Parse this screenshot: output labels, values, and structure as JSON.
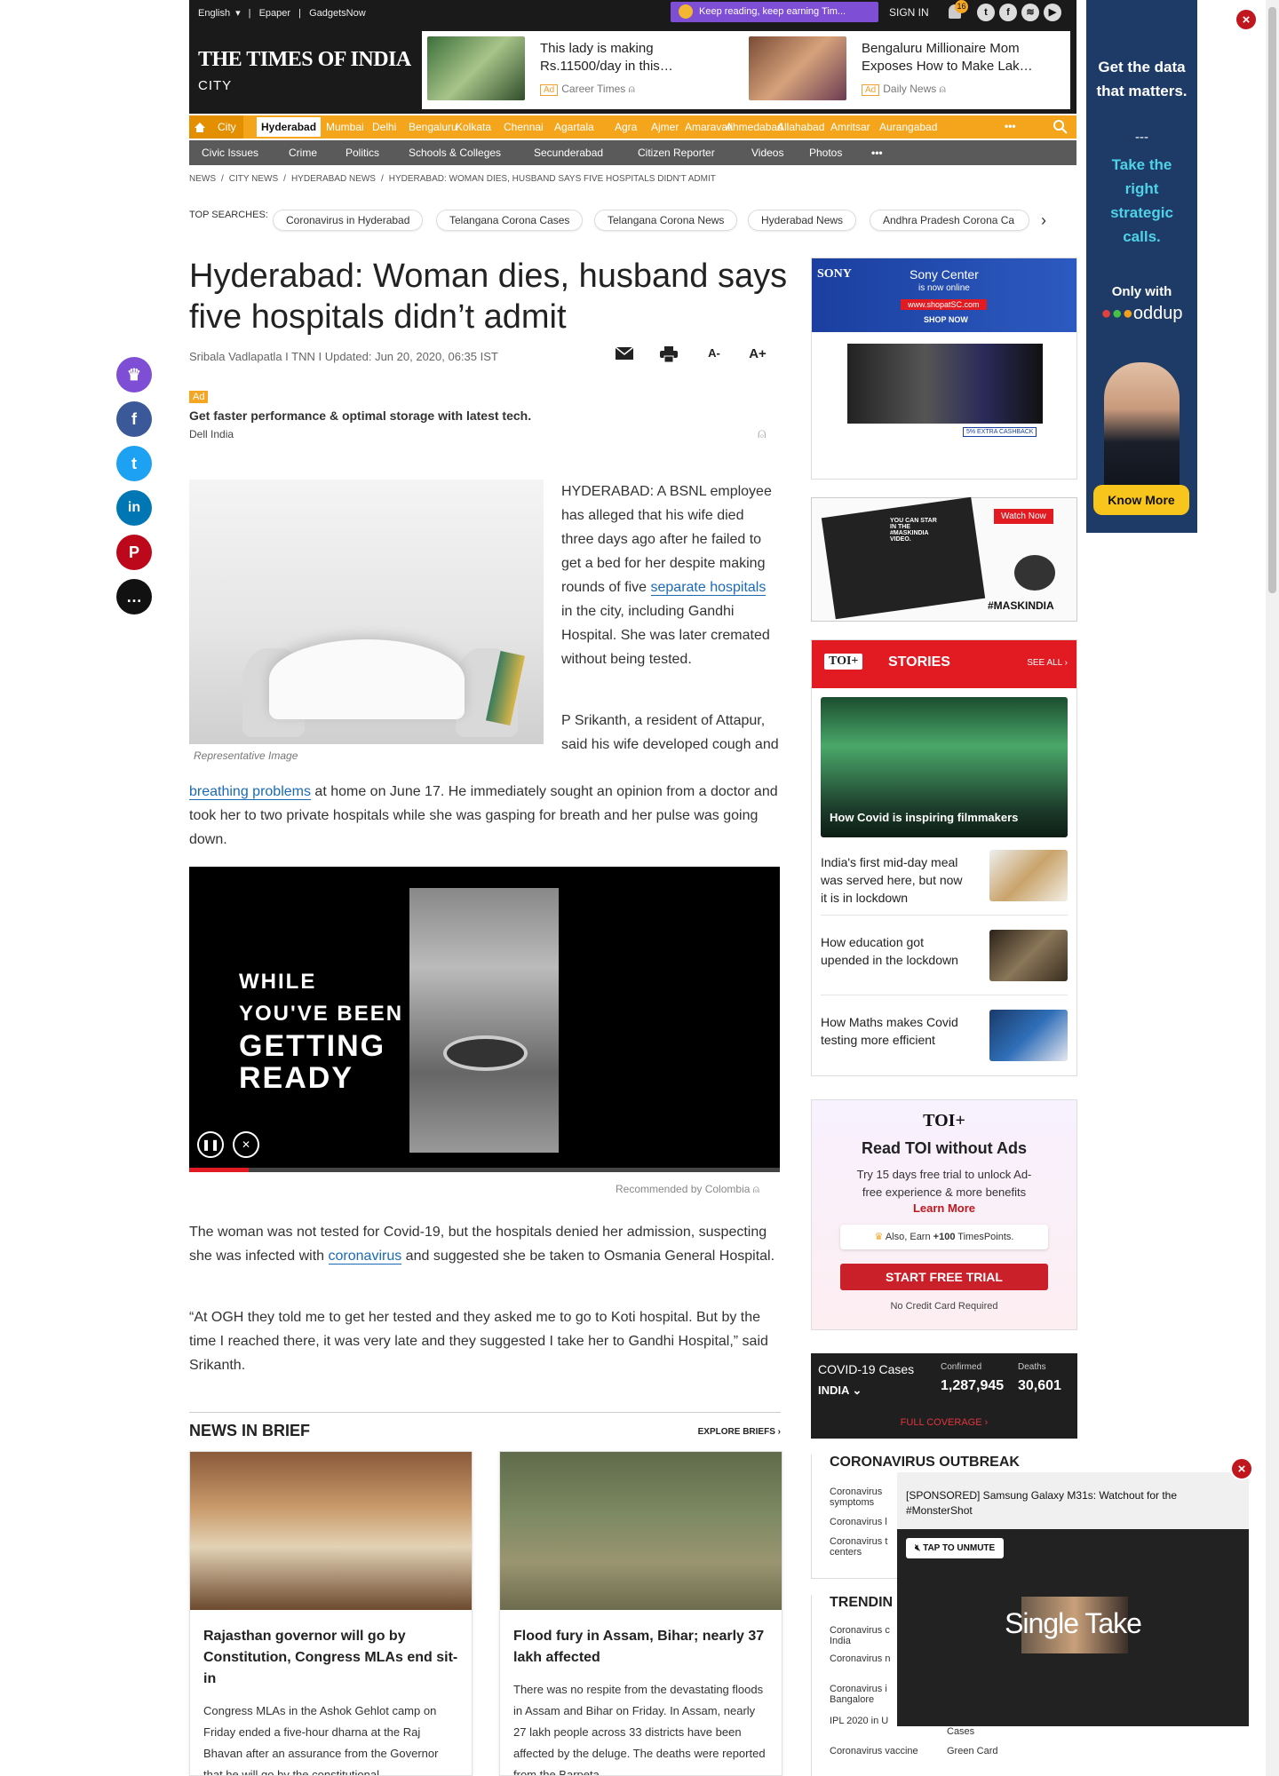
{
  "topbar": {
    "lang": "English",
    "epaper": "Epaper",
    "gadgets": "GadgetsNow",
    "promo": "Keep reading, keep earning Tim...",
    "signin": "SIGN IN",
    "notif_count": "16"
  },
  "header": {
    "logo": "THE TIMES OF INDIA",
    "section": "CITY",
    "ads": [
      {
        "title": "This lady is making Rs.11500/day in this…",
        "ad": "Ad",
        "source": "Career Times"
      },
      {
        "title": "Bengaluru Millionaire Mom Exposes How to Make Lak…",
        "ad": "Ad",
        "source": "Daily News"
      }
    ]
  },
  "nav": {
    "city": "City",
    "cities": [
      "Hyderabad",
      "Mumbai",
      "Delhi",
      "Bengaluru",
      "Kolkata",
      "Chennai",
      "Agartala",
      "Agra",
      "Ajmer",
      "Amaravati",
      "Ahmedabad",
      "Allahabad",
      "Amritsar",
      "Aurangabad"
    ],
    "more": "•••",
    "sub": [
      "Civic Issues",
      "Crime",
      "Politics",
      "Schools & Colleges",
      "Secunderabad",
      "Citizen Reporter",
      "Videos",
      "Photos",
      "•••"
    ]
  },
  "breadcrumb": [
    "NEWS",
    "/",
    "CITY NEWS",
    "/",
    "HYDERABAD NEWS",
    "/",
    "HYDERABAD: WOMAN DIES, HUSBAND SAYS FIVE HOSPITALS DIDN'T ADMIT"
  ],
  "top_searches": {
    "label": "TOP SEARCHES:",
    "items": [
      "Coronavirus in Hyderabad",
      "Telangana Corona Cases",
      "Telangana Corona News",
      "Hyderabad News",
      "Andhra Pradesh Corona Ca"
    ]
  },
  "article": {
    "title": "Hyderabad: Woman dies, husband says five hospitals didn’t admit",
    "byline": "Sribala Vadlapatla I TNN I Updated: Jun 20, 2020, 06:35 IST",
    "font_minus": "A-",
    "font_plus": "A+",
    "ad": {
      "tag": "Ad",
      "title": "Get faster performance & optimal storage with latest tech.",
      "source": "Dell India"
    },
    "caption": "Representative Image",
    "p1_a": "HYDERABAD: A BSNL employee has alleged that his wife died three days ago after he failed to get a bed for her despite making rounds of five ",
    "p1_link": "separate hospitals",
    "p1_b": " in the city, including Gandhi Hospital. She was later cremated without being tested.",
    "p2_a": "P Srikanth, a resident of Attapur, said his wife developed cough and",
    "p2_link": "breathing problems",
    "p2_b": " at home on June 17. He immediately sought an opinion from a doctor and took her to two private hospitals while she was gasping for breath and her pulse was going down.",
    "video_text": [
      "WHILE",
      "YOU'VE BEEN",
      "GETTING",
      "READY"
    ],
    "video_progress": 0.1,
    "recommended": "Recommended by Colombia",
    "p3_a": "The woman was not tested for Covid-19, but the hospitals denied her admission, suspecting she was infected with ",
    "p3_link": "coronavirus",
    "p3_b": " and suggested she be taken to Osmania General Hospital.",
    "p4": "“At OGH they told me to get her tested and they asked me to go to Koti hospital. But by the time I reached there, it was very late and they suggested I take her to Gandhi Hospital,” said Srikanth."
  },
  "briefs": {
    "title": "NEWS IN BRIEF",
    "explore": "EXPLORE BRIEFS",
    "items": [
      {
        "headline": "Rajasthan governor will go by Constitution, Congress MLAs end sit-in",
        "desc": "Congress MLAs in the Ashok Gehlot camp on Friday ended a five-hour dharna at the Raj Bhavan after an assurance from the Governor that he will go by the constitutional"
      },
      {
        "headline": "Flood fury in Assam, Bihar; nearly 37 lakh affected",
        "desc": "There was no respite from the devastating floods in Assam and Bihar on Friday. In Assam, nearly 27 lakh people across 33 districts have been affected by the deluge. The deaths were reported from the Barpeta"
      }
    ]
  },
  "sidebar": {
    "sony": {
      "brand": "SONY",
      "line1": "Sony Center",
      "line2": "is now online",
      "url": "www.shopatSC.com",
      "cta": "SHOP NOW",
      "cashback": "5% EXTRA CASHBACK"
    },
    "mask": {
      "text": "YOU CAN STAR IN THE #MASKINDIA VIDEO.",
      "cta": "Watch Now",
      "tag": "#MASKINDIA"
    },
    "stories": {
      "logo": "TOI+",
      "title": "STORIES",
      "see_all": "SEE ALL",
      "hero": "How Covid is inspiring filmmakers",
      "items": [
        "India's first mid-day meal was served here, but now it is in lockdown",
        "How education got upended in the lockdown",
        "How Maths makes Covid testing more efficient"
      ]
    },
    "noads": {
      "logo": "TOI+",
      "title": "Read TOI without Ads",
      "desc": "Try 15 days free trial to unlock Ad-free experience & more benefits",
      "learn": "Learn More",
      "earn_a": "Also, Earn ",
      "earn_b": "+100",
      "earn_c": " TimesPoints.",
      "cta": "START FREE TRIAL",
      "note": "No Credit Card Required"
    },
    "covid": {
      "label": "COVID-19 Cases",
      "region": "INDIA",
      "confirmed_label": "Confirmed",
      "confirmed": "1,287,945",
      "deaths_label": "Deaths",
      "deaths": "30,601",
      "cta": "FULL COVERAGE"
    },
    "outbreak": {
      "title": "CORONAVIRUS OUTBREAK",
      "items": [
        "Coronavirus symptoms",
        "Coronavirus l",
        "Coronavirus t centers"
      ]
    },
    "trending": {
      "title": "TRENDIN",
      "items": [
        "Coronavirus c India",
        "Coronavirus n",
        "Coronavirus i Bangalore",
        "IPL 2020 in U",
        "Coronavirus vaccine"
      ],
      "right": [
        "Cases",
        "Green Card"
      ]
    }
  },
  "skyscraper": {
    "l1": "Get the data that matters.",
    "l2": "---",
    "l3": "Take the right strategic calls.",
    "l4": "Only with",
    "brand": "oddup",
    "cta": "Know More"
  },
  "popup": {
    "title": "[SPONSORED] Samsung Galaxy M31s: Watchout for the #MonsterShot",
    "unmute": "TAP TO UNMUTE",
    "brand": "Single Take"
  },
  "colors": {
    "brand_orange": "#f4a51c",
    "toi_red": "#e21b23",
    "link": "#1a6ab5"
  }
}
